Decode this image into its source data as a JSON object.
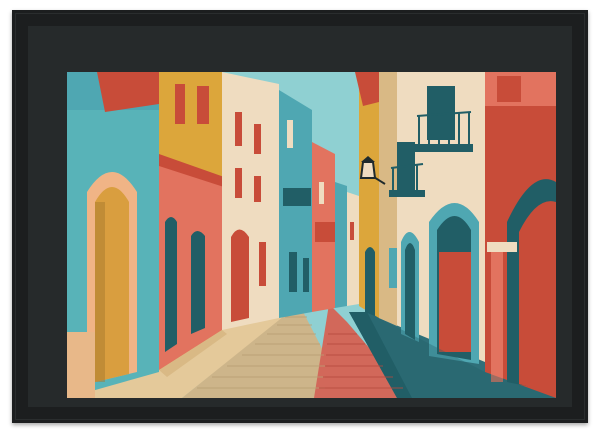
{
  "artwork": {
    "subject": "street-scene",
    "palette": {
      "frame": "#1c1e1f",
      "mat": "#262a2b",
      "sky": "#8fd0d2",
      "teal": "#4fa7b2",
      "dark_teal": "#215e66",
      "mustard": "#dca63b",
      "coral": "#e2735f",
      "terracotta": "#c84c39",
      "cream": "#efdcc0",
      "sand": "#d9b985",
      "pavement": "#cdb58a",
      "shadow": "#2f6f79"
    }
  }
}
